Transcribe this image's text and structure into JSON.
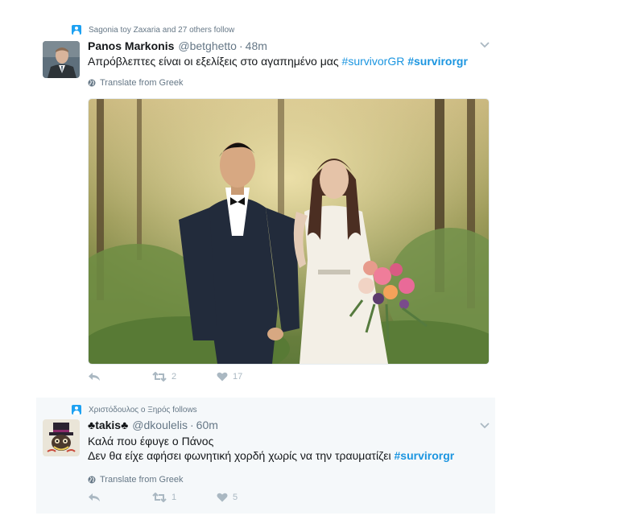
{
  "tweets": [
    {
      "context": "Sagonia toy Zaxaria and 27 others follow",
      "name": "Panos Markonis",
      "handle": "@betghetto",
      "separator": "·",
      "time": "48m",
      "text_plain": "Απρόβλεπτες είναι οι εξελίξεις στο αγαπημένο μας ",
      "hashtag1": "#survivorGR",
      "hashtag2": "#survirorgr",
      "translate": "Translate from Greek",
      "retweets": "2",
      "likes": "17"
    },
    {
      "context": "Χριστόδουλος ο Ξηρός follows",
      "name_symbol_left": "♣",
      "name": "takis",
      "name_symbol_right": "♣",
      "handle": "@dkoulelis",
      "separator": "·",
      "time": "60m",
      "line1": "Καλά που έφυγε ο Πάνος",
      "line2_plain": "Δεν θα είχε αφήσει φωνητική χορδή χωρίς να την τραυματίζει ",
      "hashtag": "#survirorgr",
      "translate": "Translate from Greek",
      "retweets": "1",
      "likes": "5"
    }
  ],
  "icons": {
    "context": "person-follow-icon",
    "caret": "chevron-down-icon",
    "translate": "globe-icon",
    "reply": "reply-icon",
    "retweet": "retweet-icon",
    "like": "heart-icon"
  },
  "colors": {
    "link": "#1b95e0",
    "muted": "#657786",
    "action": "#aab8c2",
    "highlight_bg": "#f5f8fa",
    "context_icon": "#1da1f2"
  }
}
